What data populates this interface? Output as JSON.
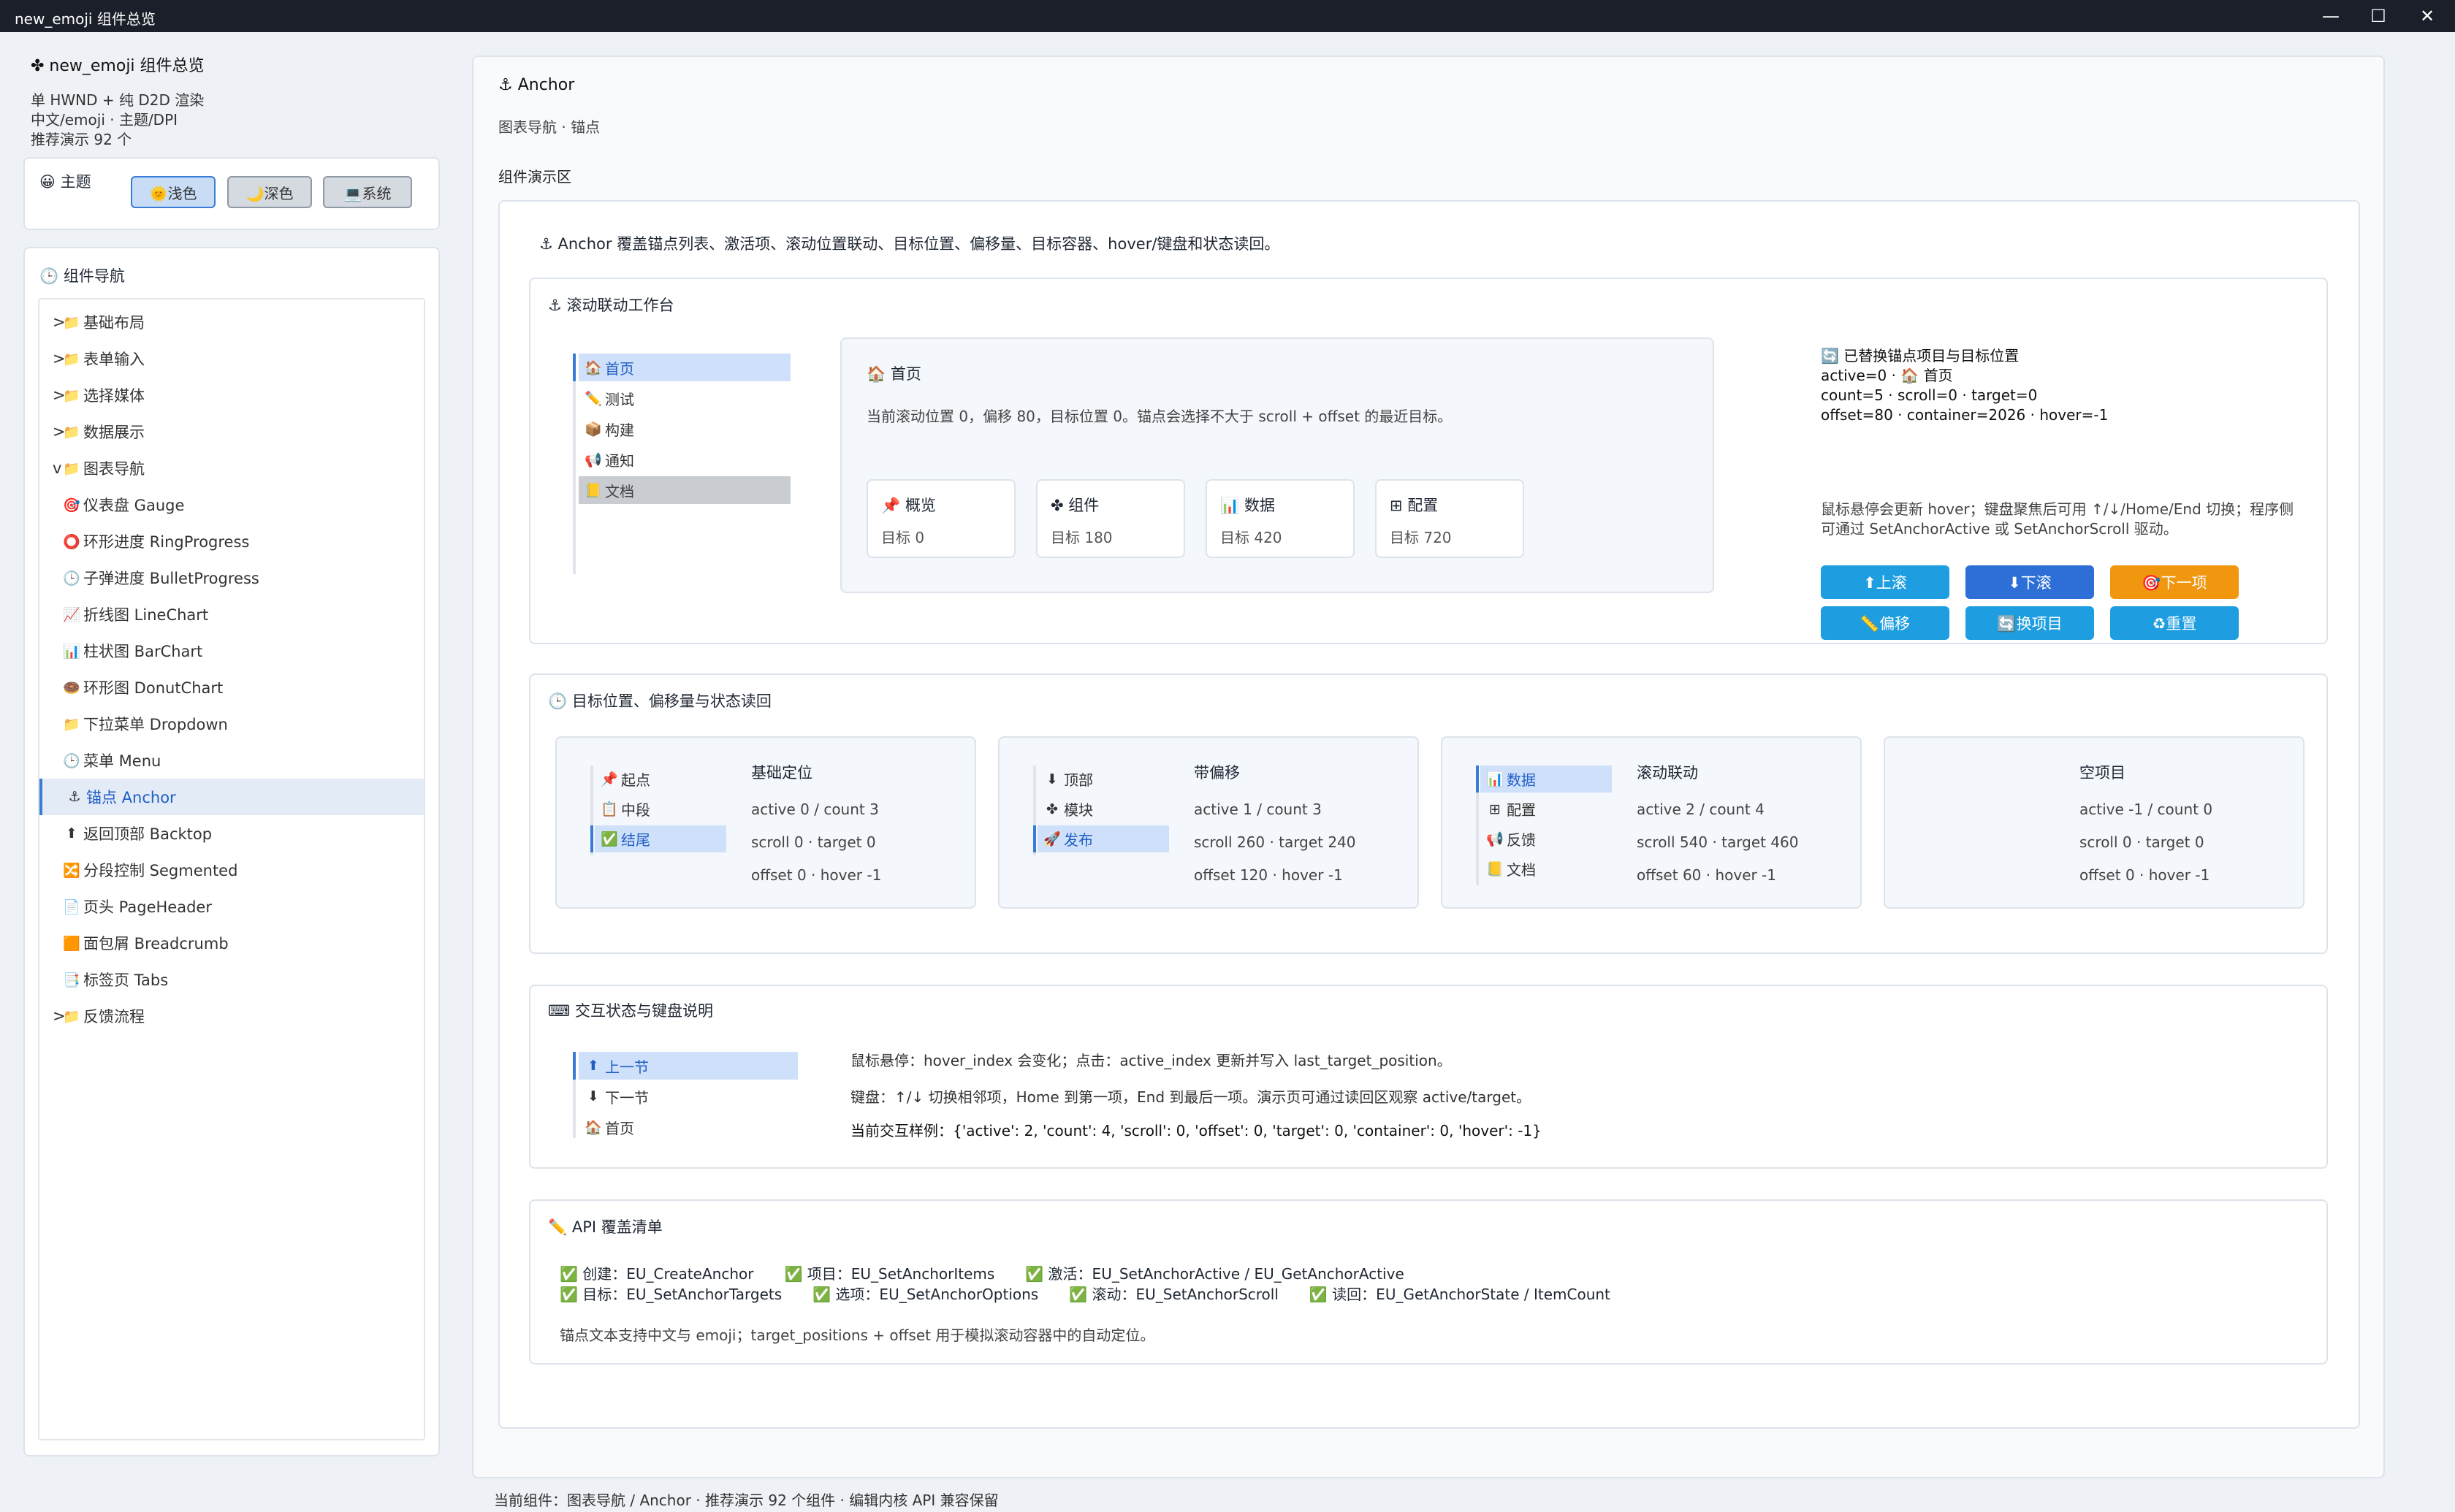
{
  "window": {
    "title": "new_emoji 组件总览",
    "icon": "✤"
  },
  "sidebar": {
    "app_title": "✤ new_emoji 组件总览",
    "info": [
      "单 HWND + 纯 D2D 渲染",
      "中文/emoji · 主题/DPI",
      "推荐演示 92 个"
    ],
    "theme": {
      "label": "😀 主题",
      "buttons": [
        "🌞浅色",
        "🌙深色",
        "💻系统"
      ],
      "active": 0
    },
    "nav_title": "🕒 组件导航",
    "items": [
      {
        "prefix": ">",
        "icon": "📁",
        "label": "基础布局",
        "level": 0
      },
      {
        "prefix": ">",
        "icon": "📁",
        "label": "表单输入",
        "level": 0
      },
      {
        "prefix": ">",
        "icon": "📁",
        "label": "选择媒体",
        "level": 0
      },
      {
        "prefix": ">",
        "icon": "📁",
        "label": "数据展示",
        "level": 0
      },
      {
        "prefix": "v",
        "icon": "📁",
        "label": "图表导航",
        "level": 0
      },
      {
        "prefix": "",
        "icon": "🎯",
        "label": "仪表盘 Gauge",
        "level": 1
      },
      {
        "prefix": "",
        "icon": "⭕",
        "label": "环形进度 RingProgress",
        "level": 1
      },
      {
        "prefix": "",
        "icon": "🕒",
        "label": "子弹进度 BulletProgress",
        "level": 1
      },
      {
        "prefix": "",
        "icon": "📈",
        "label": "折线图 LineChart",
        "level": 1
      },
      {
        "prefix": "",
        "icon": "📊",
        "label": "柱状图 BarChart",
        "level": 1
      },
      {
        "prefix": "",
        "icon": "🍩",
        "label": "环形图 DonutChart",
        "level": 1
      },
      {
        "prefix": "",
        "icon": "📁",
        "label": "下拉菜单 Dropdown",
        "level": 1
      },
      {
        "prefix": "",
        "icon": "🕒",
        "label": "菜单 Menu",
        "level": 1
      },
      {
        "prefix": "",
        "icon": "⚓",
        "label": "锚点 Anchor",
        "level": 1,
        "selected": true
      },
      {
        "prefix": "",
        "icon": "⬆",
        "label": "返回顶部 Backtop",
        "level": 1
      },
      {
        "prefix": "",
        "icon": "🔀",
        "label": "分段控制 Segmented",
        "level": 1
      },
      {
        "prefix": "",
        "icon": "📄",
        "label": "页头 PageHeader",
        "level": 1
      },
      {
        "prefix": "",
        "icon": "🟧",
        "label": "面包屑 Breadcrumb",
        "level": 1
      },
      {
        "prefix": "",
        "icon": "📑",
        "label": "标签页 Tabs",
        "level": 1
      },
      {
        "prefix": ">",
        "icon": "📁",
        "label": "反馈流程",
        "level": 0
      }
    ]
  },
  "main": {
    "title": "⚓ Anchor",
    "subtitle": "图表导航 · 锚点",
    "demo_label": "组件演示区",
    "intro": "⚓ Anchor 覆盖锚点列表、激活项、滚动位置联动、目标位置、偏移量、目标容器、hover/键盘和状态读回。",
    "workbench": {
      "title": "⚓ 滚动联动工作台",
      "anchors": [
        {
          "icon": "🏠",
          "label": "首页",
          "state": "on"
        },
        {
          "icon": "✏️",
          "label": "测试",
          "state": ""
        },
        {
          "icon": "📦",
          "label": "构建",
          "state": ""
        },
        {
          "icon": "📢",
          "label": "通知",
          "state": ""
        },
        {
          "icon": "📒",
          "label": "文档",
          "state": "dim"
        }
      ],
      "content_title": "🏠 首页",
      "content_text": "当前滚动位置 0，偏移 80，目标位置 0。锚点会选择不大于 scroll + offset 的最近目标。",
      "chips": [
        {
          "title": "📌 概览",
          "target": "目标 0"
        },
        {
          "title": "✤ 组件",
          "target": "目标 180"
        },
        {
          "title": "📊 数据",
          "target": "目标 420"
        },
        {
          "title": "⊞ 配置",
          "target": "目标 720"
        }
      ],
      "status_lines": [
        "🔄 已替换锚点项目与目标位置",
        "active=0 · 🏠 首页",
        "count=5 · scroll=0 · target=0",
        "offset=80 · container=2026 · hover=-1"
      ],
      "hint_lines": [
        "鼠标悬停会更新 hover；键盘聚焦后可用 ↑/↓/Home/End 切换；程序侧",
        "可通过 SetAnchorActive 或 SetAnchorScroll 驱动。"
      ],
      "buttons": [
        {
          "label": "⬆上滚",
          "color": "#1e9ee0"
        },
        {
          "label": "⬇下滚",
          "color": "#2d6fd6"
        },
        {
          "label": "🎯下一项",
          "color": "#f0960f"
        },
        {
          "label": "📏偏移",
          "color": "#1e9ee0"
        },
        {
          "label": "🔄换项目",
          "color": "#1e9ee0"
        },
        {
          "label": "♻重置",
          "color": "#1e9ee0"
        }
      ]
    },
    "targets": {
      "title": "🕒 目标位置、偏移量与状态读回",
      "cards": [
        {
          "items": [
            {
              "icon": "📌",
              "label": "起点",
              "on": false
            },
            {
              "icon": "📋",
              "label": "中段",
              "on": false
            },
            {
              "icon": "✅",
              "label": "结尾",
              "on": true
            }
          ],
          "title": "基础定位",
          "lines": [
            "active 0 / count 3",
            "scroll 0 · target 0",
            "offset 0 · hover -1"
          ]
        },
        {
          "items": [
            {
              "icon": "⬇",
              "label": "顶部",
              "on": false
            },
            {
              "icon": "✤",
              "label": "模块",
              "on": false
            },
            {
              "icon": "🚀",
              "label": "发布",
              "on": true
            }
          ],
          "title": "带偏移",
          "lines": [
            "active 1 / count 3",
            "scroll 260 · target 240",
            "offset 120 · hover -1"
          ]
        },
        {
          "items": [
            {
              "icon": "📊",
              "label": "数据",
              "on": true
            },
            {
              "icon": "⊞",
              "label": "配置",
              "on": false
            },
            {
              "icon": "📢",
              "label": "反馈",
              "on": false
            },
            {
              "icon": "📒",
              "label": "文档",
              "on": false
            }
          ],
          "title": "滚动联动",
          "lines": [
            "active 2 / count 4",
            "scroll 540 · target 460",
            "offset 60 · hover -1"
          ]
        },
        {
          "items": [],
          "title": "空项目",
          "lines": [
            "active -1 / count 0",
            "scroll 0 · target 0",
            "offset 0 · hover -1"
          ]
        }
      ]
    },
    "interaction": {
      "title": "⌨ 交互状态与键盘说明",
      "anchors": [
        {
          "icon": "⬆",
          "label": "上一节",
          "on": true
        },
        {
          "icon": "⬇",
          "label": "下一节",
          "on": false
        },
        {
          "icon": "🏠",
          "label": "首页",
          "on": false
        }
      ],
      "lines": [
        "鼠标悬停：hover_index 会变化；点击：active_index 更新并写入 last_target_position。",
        "键盘：↑/↓ 切换相邻项，Home 到第一项，End 到最后一项。演示页可通过读回区观察 active/target。",
        "当前交互样例：{'active': 2, 'count': 4, 'scroll': 0, 'offset': 0, 'target': 0, 'container': 0, 'hover': -1}"
      ]
    },
    "api": {
      "title": "✏️ API 覆盖清单",
      "row1": [
        "✅ 创建：EU_CreateAnchor",
        "✅ 项目：EU_SetAnchorItems",
        "✅ 激活：EU_SetAnchorActive / EU_GetAnchorActive"
      ],
      "row2": [
        "✅ 目标：EU_SetAnchorTargets",
        "✅ 选项：EU_SetAnchorOptions",
        "✅ 滚动：EU_SetAnchorScroll",
        "✅ 读回：EU_GetAnchorState / ItemCount"
      ],
      "note": "锚点文本支持中文与 emoji；target_positions + offset 用于模拟滚动容器中的自动定位。"
    }
  },
  "status_bar": "当前组件：图表导航 / Anchor · 推荐演示 92 个组件 · 编辑内核 API 兼容保留"
}
